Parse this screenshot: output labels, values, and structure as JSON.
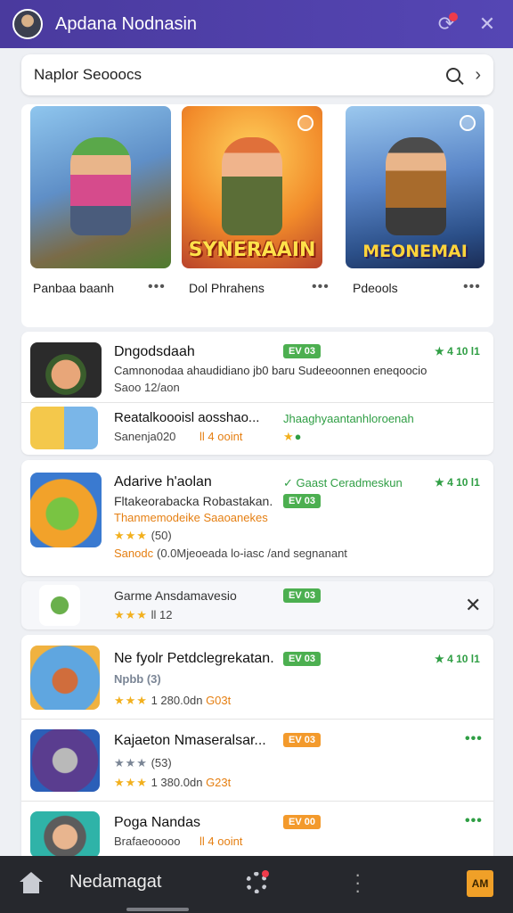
{
  "header": {
    "title": "Apdana Nodnasin"
  },
  "search": {
    "text": "Naplor Seooocs"
  },
  "featured": [
    {
      "label": "Panbaa baanh",
      "banner": ""
    },
    {
      "label": "Dol Phrahens",
      "banner": "SYNERAAIN"
    },
    {
      "label": "Pdeools",
      "banner": "MEONEMAI"
    }
  ],
  "list1": [
    {
      "title": "Dngodsdaah",
      "badge": "EV 03",
      "rating": "★ 4 10 l1",
      "desc": "Camnonodaa ahaudidiano jb0 baru Sudeeoonnen eneqoocio",
      "meta": "Saoo 12/aon"
    },
    {
      "title": "Reatalkoooisl aosshao...",
      "meta": "Sanenja020",
      "orange": "ll 4 ooint",
      "green_line": "Jhaaghyaantanhloroenah"
    }
  ],
  "card2": {
    "title": "Adarive h'aolan",
    "badge_top": "✓ Gaast  Ceradmeskun",
    "rating": "★ 4 10 l1",
    "line1": "Fltakeorabacka Robastakan.",
    "badge": "EV 03",
    "line2": "Thanmemodeike Saaoanekes",
    "stars": "★★★",
    "rating_count": "(50)",
    "line3_orange": "Sanodc",
    "line3": "(0.0Mjeoeada lo-iasc /and segnanant"
  },
  "promo": {
    "title": "Garme Ansdamavesio",
    "badge": "EV 03",
    "meta": "ll 12"
  },
  "list3": [
    {
      "title": "Ne fyolr Petdclegrekatan.",
      "badge": "EV 03",
      "rating": "★ 4 10 l1",
      "sub": "Npbb (3)",
      "orange": "1 280.0dn",
      "extra": "G03t"
    },
    {
      "title": "Kajaeton  Nmaseralsar...",
      "badge": "EV 03",
      "sub": "(53)",
      "orange": "1 380.0dn",
      "extra": "G23t"
    },
    {
      "title": "Poga Nandas",
      "badge": "EV 00",
      "sub": "Brafaeooooo",
      "orange": "ll 4 ooint"
    }
  ],
  "bottomnav": {
    "label": "Nedamagat",
    "button": "AM"
  }
}
